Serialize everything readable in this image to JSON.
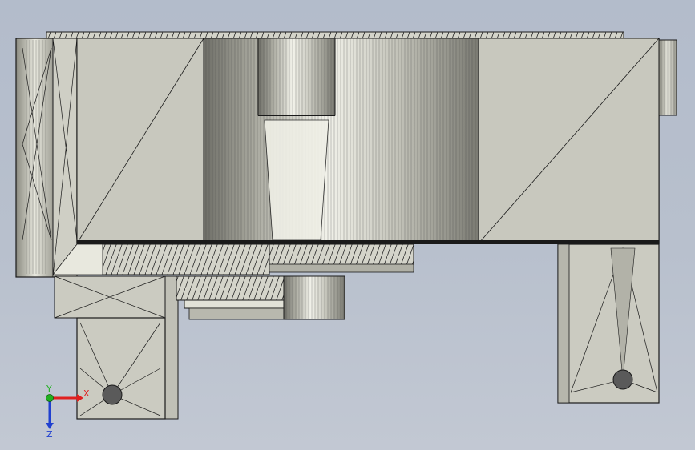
{
  "viewport": {
    "background_top": "#b3bccb",
    "background_bottom": "#c2c8d3"
  },
  "model": {
    "face_color": "#c9c9bf",
    "face_light": "#e6e6dc",
    "face_dark": "#8e8e84",
    "edge_color": "#1a1a1a"
  },
  "triad": {
    "x_label": "X",
    "y_label": "Y",
    "z_label": "Z",
    "x_color": "#e02020",
    "y_color": "#20b020",
    "z_color": "#2040d0"
  }
}
